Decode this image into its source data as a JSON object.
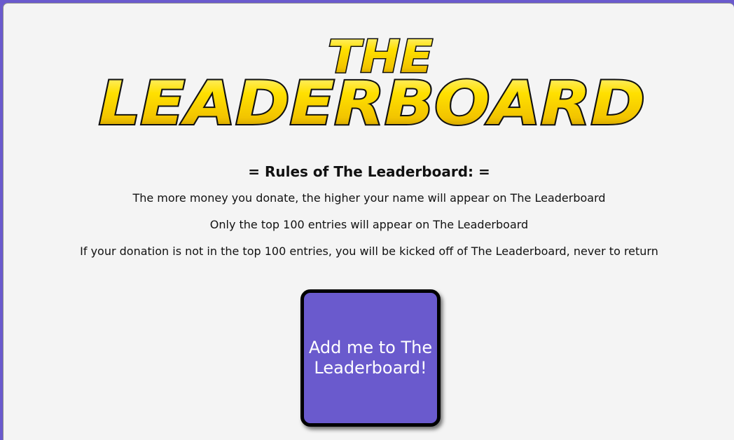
{
  "logo": {
    "line1": "THE",
    "line2": "LEADERBOARD",
    "colors": {
      "fill_top": "#fff27a",
      "fill_mid": "#ffd400",
      "fill_bottom": "#b88a00",
      "outline": "#111111"
    }
  },
  "rules": {
    "heading": "= Rules of The Leaderboard: =",
    "items": [
      "The more money you donate, the higher your name will appear on The Leaderboard",
      "Only the top 100 entries will appear on The Leaderboard",
      "If your donation is not in the top 100 entries, you will be kicked off of The Leaderboard, never to return"
    ]
  },
  "add_button": {
    "label": "Add me to The Leaderboard!"
  },
  "colors": {
    "accent": "#6a5acd",
    "page_background": "#f4f4f4"
  }
}
